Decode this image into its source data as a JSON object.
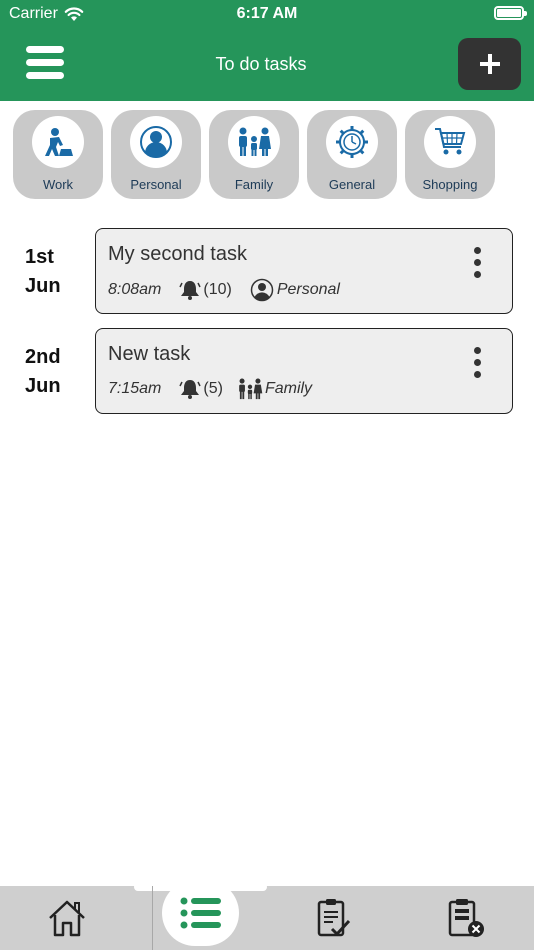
{
  "status_bar": {
    "carrier": "Carrier",
    "time": "6:17 AM"
  },
  "header": {
    "title": "To do tasks",
    "menu_icon": "hamburger-icon",
    "add_icon": "plus-icon"
  },
  "categories": [
    {
      "label": "Work",
      "icon": "worker-icon"
    },
    {
      "label": "Personal",
      "icon": "person-icon"
    },
    {
      "label": "Family",
      "icon": "family-icon"
    },
    {
      "label": "General",
      "icon": "gear-clock-icon"
    },
    {
      "label": "Shopping",
      "icon": "shopping-cart-icon"
    }
  ],
  "tasks": [
    {
      "date_day": "1st",
      "date_month": "Jun",
      "name": "My second task",
      "time": "8:08am",
      "reminders": "(10)",
      "category": "Personal"
    },
    {
      "date_day": "2nd",
      "date_month": "Jun",
      "name": "New task",
      "time": "7:15am",
      "reminders": "(5)",
      "category": "Family"
    }
  ],
  "tabbar": {
    "tabs": [
      {
        "name": "home",
        "icon": "home-icon"
      },
      {
        "name": "tasks",
        "icon": "list-icon",
        "active": true
      },
      {
        "name": "completed",
        "icon": "clipboard-check-icon"
      },
      {
        "name": "deleted",
        "icon": "clipboard-delete-icon"
      }
    ]
  },
  "colors": {
    "header": "#25955a",
    "category_bg": "#c9c9c9",
    "icon_blue": "#1a6aa6",
    "tabbar": "#cfcfcf",
    "active_tab_icon": "#25955a"
  }
}
